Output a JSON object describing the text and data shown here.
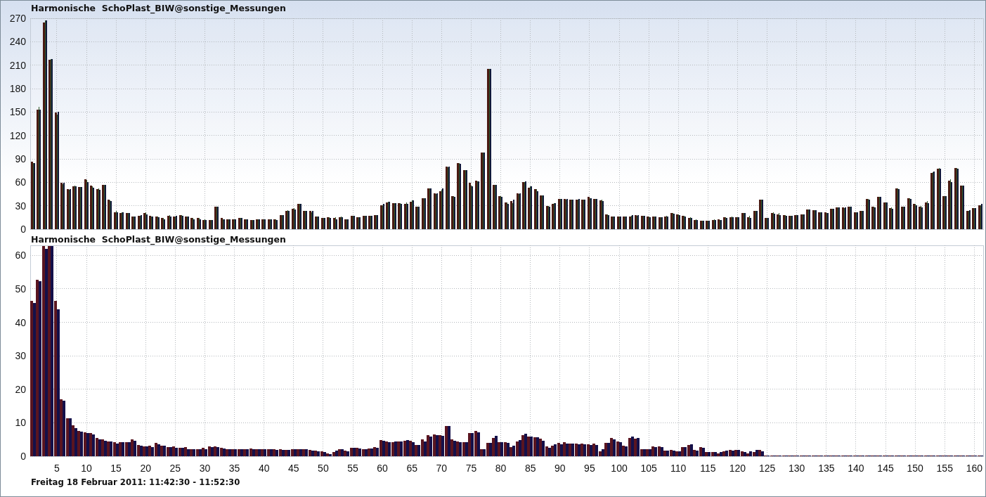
{
  "charts": [
    {
      "title": "Harmonische  SchoPlast_BIW@sonstige_Messungen",
      "chart_data": {
        "type": "bar",
        "grid": true,
        "ylim": [
          0,
          270
        ],
        "yticks": [
          0,
          30,
          60,
          90,
          120,
          150,
          180,
          210,
          240,
          270
        ],
        "series": [
          {
            "color": "#4a1a12",
            "values": [
              86,
              153,
              265,
              217,
              149,
              59,
              51,
              55,
              54,
              64,
              56,
              51,
              57,
              38,
              22,
              21,
              21,
              16,
              17,
              21,
              17,
              16,
              14,
              17,
              16,
              18,
              16,
              14,
              14,
              12,
              12,
              29,
              14,
              13,
              13,
              14,
              13,
              12,
              13,
              13,
              13,
              13,
              18,
              23,
              26,
              32,
              23,
              23,
              16,
              14,
              15,
              14,
              15,
              13,
              17,
              15,
              17,
              17,
              18,
              31,
              34,
              33,
              33,
              32,
              35,
              29,
              40,
              52,
              46,
              49,
              80,
              42,
              85,
              76,
              59,
              62,
              98,
              205,
              57,
              42,
              34,
              36,
              46,
              60,
              53,
              51,
              43,
              30,
              32,
              39,
              39,
              38,
              38,
              38,
              41,
              39,
              37,
              19,
              16,
              16,
              16,
              16,
              18,
              17,
              16,
              16,
              15,
              16,
              21,
              19,
              17,
              14,
              12,
              11,
              11,
              12,
              13,
              15,
              15,
              15,
              21,
              15,
              23,
              38,
              14,
              21,
              19,
              18,
              17,
              18,
              19,
              25,
              24,
              22,
              22,
              26,
              28,
              28,
              29,
              22,
              23,
              39,
              29,
              41,
              34,
              27,
              52,
              29,
              40,
              32,
              29,
              34,
              72,
              77,
              42,
              62,
              78,
              56,
              23,
              27,
              31
            ]
          },
          {
            "color": "#2f5a2c",
            "values": [
              85,
              157,
              267,
              218,
              147,
              58,
              50,
              56,
              54,
              63,
              55,
              52,
              57,
              37,
              23,
              22,
              21,
              16,
              17,
              22,
              16,
              16,
              14,
              18,
              16,
              18,
              16,
              14,
              14,
              13,
              12,
              29,
              13,
              13,
              13,
              14,
              13,
              12,
              13,
              13,
              13,
              13,
              18,
              24,
              27,
              32,
              23,
              22,
              16,
              14,
              15,
              15,
              16,
              13,
              17,
              15,
              17,
              17,
              18,
              31,
              35,
              33,
              33,
              34,
              37,
              29,
              40,
              52,
              45,
              50,
              79,
              42,
              85,
              76,
              56,
              61,
              98,
              205,
              57,
              42,
              34,
              33,
              45,
              60,
              55,
              51,
              43,
              30,
              33,
              39,
              38,
              38,
              38,
              38,
              40,
              39,
              38,
              19,
              16,
              16,
              16,
              17,
              17,
              17,
              16,
              16,
              15,
              17,
              21,
              19,
              17,
              15,
              13,
              11,
              11,
              13,
              12,
              15,
              16,
              15,
              21,
              17,
              23,
              38,
              14,
              22,
              21,
              18,
              17,
              18,
              19,
              25,
              24,
              22,
              21,
              26,
              28,
              27,
              29,
              22,
              23,
              39,
              29,
              41,
              34,
              28,
              52,
              29,
              40,
              32,
              30,
              36,
              73,
              78,
              42,
              64,
              78,
              56,
              23,
              27,
              31
            ]
          },
          {
            "color": "#10183a",
            "values": [
              85,
              153,
              267,
              218,
              150,
              59,
              51,
              55,
              54,
              60,
              53,
              50,
              57,
              36,
              22,
              22,
              21,
              16,
              18,
              19,
              16,
              15,
              13,
              16,
              17,
              17,
              16,
              13,
              13,
              12,
              12,
              29,
              13,
              13,
              13,
              14,
              13,
              12,
              13,
              13,
              13,
              12,
              18,
              23,
              25,
              32,
              23,
              23,
              16,
              14,
              14,
              13,
              15,
              13,
              17,
              15,
              17,
              17,
              18,
              32,
              35,
              33,
              32,
              32,
              37,
              29,
              40,
              52,
              46,
              52,
              80,
              41,
              84,
              76,
              55,
              61,
              98,
              205,
              57,
              41,
              32,
              38,
              46,
              61,
              55,
              49,
              43,
              29,
              33,
              39,
              39,
              38,
              39,
              38,
              40,
              39,
              36,
              18,
              16,
              16,
              16,
              18,
              18,
              17,
              15,
              16,
              15,
              16,
              20,
              18,
              16,
              14,
              12,
              11,
              11,
              12,
              12,
              14,
              15,
              15,
              21,
              14,
              23,
              38,
              14,
              20,
              18,
              17,
              17,
              18,
              19,
              25,
              24,
              22,
              21,
              26,
              28,
              28,
              29,
              22,
              23,
              38,
              28,
              41,
              34,
              26,
              51,
              29,
              39,
              31,
              28,
              33,
              74,
              77,
              42,
              60,
              77,
              56,
              24,
              27,
              32
            ]
          }
        ]
      }
    },
    {
      "title": "Harmonische  SchoPlast_BIW@sonstige_Messungen",
      "chart_data": {
        "type": "bar",
        "grid": true,
        "ylim": [
          0,
          63
        ],
        "yticks": [
          0,
          10,
          20,
          30,
          40,
          50,
          60
        ],
        "x": [
          1,
          2,
          3,
          4,
          5,
          6,
          7,
          8,
          9,
          10,
          11,
          12,
          13,
          14,
          15,
          16,
          17,
          18,
          19,
          20,
          21,
          22,
          23,
          24,
          25,
          26,
          27,
          28,
          29,
          30,
          31,
          32,
          33,
          34,
          35,
          36,
          37,
          38,
          39,
          40,
          41,
          42,
          43,
          44,
          45,
          46,
          47,
          48,
          49,
          50,
          51,
          52,
          53,
          54,
          55,
          56,
          57,
          58,
          59,
          60,
          61,
          62,
          63,
          64,
          65,
          66,
          67,
          68,
          69,
          70,
          71,
          72,
          73,
          74,
          75,
          76,
          77,
          78,
          79,
          80,
          81,
          82,
          83,
          84,
          85,
          86,
          87,
          88,
          89,
          90,
          91,
          92,
          93,
          94,
          95,
          96,
          97,
          98,
          99,
          100,
          101,
          102,
          103,
          104,
          105,
          106,
          107,
          108,
          109,
          110,
          111,
          112,
          113,
          114,
          115,
          116,
          117,
          118,
          119,
          120,
          121,
          122,
          123,
          124,
          125,
          126,
          127,
          128,
          129,
          130,
          131,
          132,
          133,
          134,
          135,
          136,
          137,
          138,
          139,
          140,
          141,
          142,
          143,
          144,
          145,
          146,
          147,
          148,
          149,
          150,
          151,
          152,
          153,
          154,
          155,
          156,
          157,
          158,
          159,
          160,
          161
        ],
        "xlim": [
          0.5,
          161.5
        ],
        "xticks": [
          5,
          10,
          15,
          20,
          25,
          30,
          35,
          40,
          45,
          50,
          55,
          60,
          65,
          70,
          75,
          80,
          85,
          90,
          95,
          100,
          105,
          110,
          115,
          120,
          125,
          130,
          135,
          140,
          145,
          150,
          155,
          160
        ],
        "series": [
          {
            "color": "#5a1520",
            "values": [
              46.5,
              52.8,
              62.7,
              62.7,
              46.5,
              17,
              11.3,
              9.2,
              7.6,
              7.2,
              7,
              5.5,
              5.1,
              4.5,
              4.1,
              4.1,
              4.1,
              5.1,
              3.4,
              3,
              3.2,
              4,
              3.2,
              2.8,
              3,
              2.6,
              2.8,
              2.2,
              2.2,
              2.6,
              3,
              3,
              2.6,
              2.2,
              2.2,
              2.2,
              2,
              2.4,
              2.2,
              2,
              2,
              2,
              2,
              1.8,
              2.2,
              2.2,
              2.2,
              1.8,
              1.6,
              1.5,
              0.8,
              1.2,
              2.2,
              1.6,
              2.6,
              2.6,
              2.2,
              2.4,
              2.8,
              4.8,
              4.4,
              4.3,
              4.4,
              4.6,
              4.6,
              3.4,
              5,
              6.2,
              6.6,
              6.2,
              9,
              5,
              4.5,
              4.2,
              7,
              7.5,
              2.2,
              4,
              5.5,
              4.2,
              4.2,
              2.8,
              4.4,
              6.3,
              5.8,
              5.6,
              5.2,
              3,
              3.2,
              4,
              4.2,
              3.8,
              3.8,
              3.8,
              3.6,
              3.8,
              1.5,
              4,
              5.5,
              4.5,
              3.2,
              5.5,
              5.2,
              2.2,
              2.2,
              3,
              3,
              1.6,
              1.8,
              1.5,
              2.8,
              3.3,
              1.8,
              2.8,
              1.3,
              1.3,
              0.8,
              1.5,
              1.8,
              1.8,
              1.5,
              0.8,
              1.3,
              1.8,
              0,
              0,
              0,
              0,
              0,
              0,
              0,
              0,
              0,
              0,
              0,
              0,
              0,
              0,
              0,
              0,
              0,
              0,
              0,
              0,
              0,
              0,
              0,
              0,
              0,
              0,
              0,
              0,
              0,
              0,
              0,
              0,
              0,
              0,
              0,
              0,
              0
            ]
          },
          {
            "color": "#14104a",
            "values": [
              45.7,
              52.3,
              62,
              62.7,
              43.8,
              16.6,
              11.3,
              8.4,
              7.4,
              7,
              6.6,
              5.1,
              4.6,
              4.5,
              3.8,
              4.1,
              4.3,
              4.7,
              3.2,
              3,
              2.8,
              3.6,
              3.2,
              2.8,
              2.6,
              2.6,
              2.2,
              2.2,
              2.2,
              2.2,
              2.8,
              2.8,
              2.4,
              2.2,
              2.2,
              2.2,
              2,
              2.2,
              2,
              2,
              2,
              1.8,
              1.8,
              1.8,
              2.2,
              2,
              2,
              1.6,
              1.5,
              1.2,
              0.6,
              1.6,
              2,
              1.5,
              2.6,
              2.4,
              2.2,
              2.4,
              2.6,
              4.6,
              4.2,
              4.4,
              4.4,
              4.8,
              4.2,
              3.4,
              4.4,
              5.8,
              6.4,
              6,
              9,
              4.6,
              4.2,
              4.2,
              7,
              7.2,
              2.2,
              4,
              6,
              4.2,
              4,
              3.2,
              4.8,
              6.8,
              5.8,
              5.6,
              4.6,
              2.5,
              3.6,
              3.6,
              3.8,
              3.8,
              3.6,
              3.6,
              3.4,
              3.4,
              2,
              4,
              5,
              4.2,
              3,
              5.8,
              5.4,
              2.2,
              2.1,
              2.8,
              2.8,
              1.6,
              1.6,
              1.5,
              2.8,
              3.5,
              1.6,
              2.6,
              1.3,
              1.2,
              1.2,
              1.6,
              1.6,
              1.8,
              1.2,
              1.5,
              1.8,
              1.4,
              0,
              0,
              0,
              0,
              0,
              0,
              0,
              0,
              0,
              0,
              0,
              0,
              0,
              0,
              0,
              0,
              0,
              0,
              0,
              0,
              0,
              0,
              0,
              0,
              0,
              0,
              0,
              0,
              0,
              0,
              0,
              0,
              0,
              0,
              0,
              0,
              0
            ]
          }
        ]
      }
    }
  ],
  "footer": "Freitag 18 Februar 2011: 11:42:30 - 11:52:30"
}
